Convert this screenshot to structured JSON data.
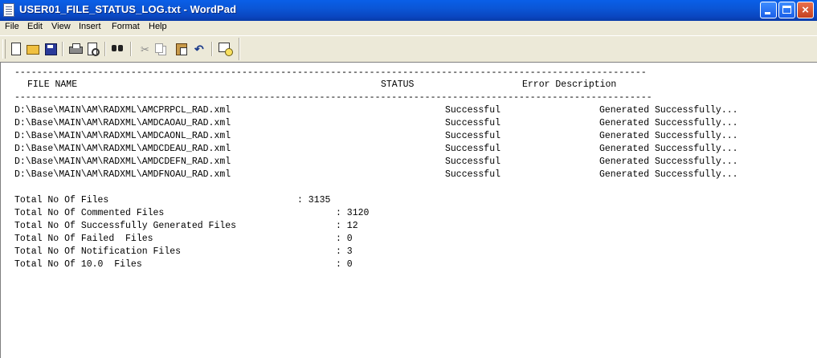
{
  "window": {
    "title": "USER01_FILE_STATUS_LOG.txt - WordPad",
    "close_glyph": "×"
  },
  "menu": [
    "File",
    "Edit",
    "View",
    "Insert",
    "Format",
    "Help"
  ],
  "toolbar": {
    "buttons": [
      "new-icon",
      "open-icon",
      "save-icon",
      "print-icon",
      "print-preview-icon",
      "find-icon",
      "cut-icon",
      "copy-icon",
      "paste-icon",
      "undo-icon",
      "date-time-icon"
    ]
  },
  "document": {
    "separator_top": "------------------------------------------------------------------------------------------------------------------",
    "separator_mid": "-------------------------------------------------------------------------------------------------------------------",
    "headers": {
      "file_name": "FILE NAME",
      "status": "STATUS",
      "error": "Error Description"
    },
    "rows": [
      {
        "file": "D:\\Base\\MAIN\\AM\\RADXML\\AMCPRPCL_RAD.xml",
        "status": "Successful",
        "description": "Generated Successfully..."
      },
      {
        "file": "D:\\Base\\MAIN\\AM\\RADXML\\AMDCAOAU_RAD.xml",
        "status": "Successful",
        "description": "Generated Successfully..."
      },
      {
        "file": "D:\\Base\\MAIN\\AM\\RADXML\\AMDCAONL_RAD.xml",
        "status": "Successful",
        "description": "Generated Successfully..."
      },
      {
        "file": "D:\\Base\\MAIN\\AM\\RADXML\\AMDCDEAU_RAD.xml",
        "status": "Successful",
        "description": "Generated Successfully..."
      },
      {
        "file": "D:\\Base\\MAIN\\AM\\RADXML\\AMDCDEFN_RAD.xml",
        "status": "Successful",
        "description": "Generated Successfully..."
      },
      {
        "file": "D:\\Base\\MAIN\\AM\\RADXML\\AMDFNOAU_RAD.xml",
        "status": "Successful",
        "description": "Generated Successfully..."
      }
    ],
    "totals": [
      {
        "label": "Total No Of Files",
        "value": ": 3135"
      },
      {
        "label": "Total No Of Commented Files",
        "value": ": 3120"
      },
      {
        "label": "Total No Of Successfully Generated Files",
        "value": ": 12"
      },
      {
        "label": "Total No Of Failed  Files",
        "value": ": 0"
      },
      {
        "label": "Total No Of Notification Files",
        "value": ": 3"
      },
      {
        "label": "Total No Of 10.0  Files",
        "value": ": 0"
      }
    ]
  }
}
